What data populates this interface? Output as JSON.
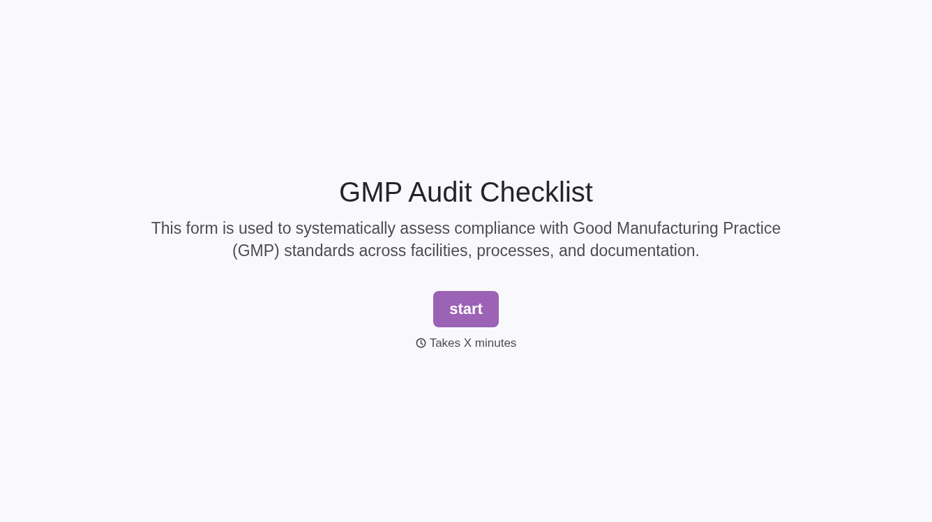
{
  "title": "GMP Audit Checklist",
  "description": "This form is used to systematically assess compliance with Good Manufacturing Practice (GMP) standards across facilities, processes, and documentation.",
  "start_button": {
    "label": "start"
  },
  "duration": {
    "text": "Takes X minutes"
  }
}
